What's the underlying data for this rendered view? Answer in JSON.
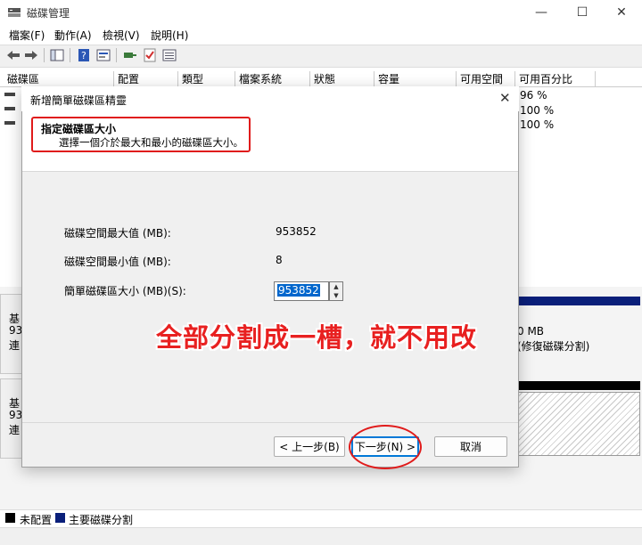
{
  "window": {
    "title": "磁碟管理",
    "controls": {
      "minimize": "—",
      "maximize": "☐",
      "close": "✕"
    }
  },
  "menu": [
    "檔案(F)",
    "動作(A)",
    "檢視(V)",
    "說明(H)"
  ],
  "toolbar": {
    "icons": [
      "back-arrow-icon",
      "forward-arrow-icon",
      "console-tree-icon",
      "help-icon",
      "properties-icon",
      "connect-icon",
      "check-icon",
      "list-icon"
    ]
  },
  "volume_list": {
    "columns": [
      "磁碟區",
      "配置",
      "類型",
      "檔案系統",
      "狀態",
      "容量",
      "可用空間",
      "可用百分比"
    ],
    "rows": [
      {
        "free_pct": "96 %"
      },
      {
        "free_pct": "100 %"
      },
      {
        "free_pct": "100 %"
      }
    ]
  },
  "disk_area": {
    "disk0": {
      "label_partial": "基",
      "size_partial": "93",
      "status_partial": "連"
    },
    "disk1": {
      "label_partial": "基",
      "size_partial": "93",
      "status_partial": "連"
    },
    "partition_text_1": "0 MB",
    "partition_text_2": "(修復磁碟分割)"
  },
  "legend": {
    "unallocated": "未配置",
    "primary": "主要磁碟分割",
    "colors": {
      "unallocated": "#000000",
      "primary": "#0a1f7a"
    }
  },
  "wizard": {
    "title": "新增簡單磁碟區精靈",
    "step_title": "指定磁碟區大小",
    "step_desc": "選擇一個介於最大和最小的磁碟區大小。",
    "max_label": "磁碟空間最大值 (MB):",
    "max_value": "953852",
    "min_label": "磁碟空間最小值 (MB):",
    "min_value": "8",
    "size_label": "簡單磁碟區大小 (MB)(S):",
    "size_value": "953852",
    "back_button": "< 上一步(B)",
    "next_button": "下一步(N) >",
    "cancel_button": "取消"
  },
  "annotation": {
    "text": "全部分割成一槽，就不用改",
    "color": "#e82020"
  }
}
